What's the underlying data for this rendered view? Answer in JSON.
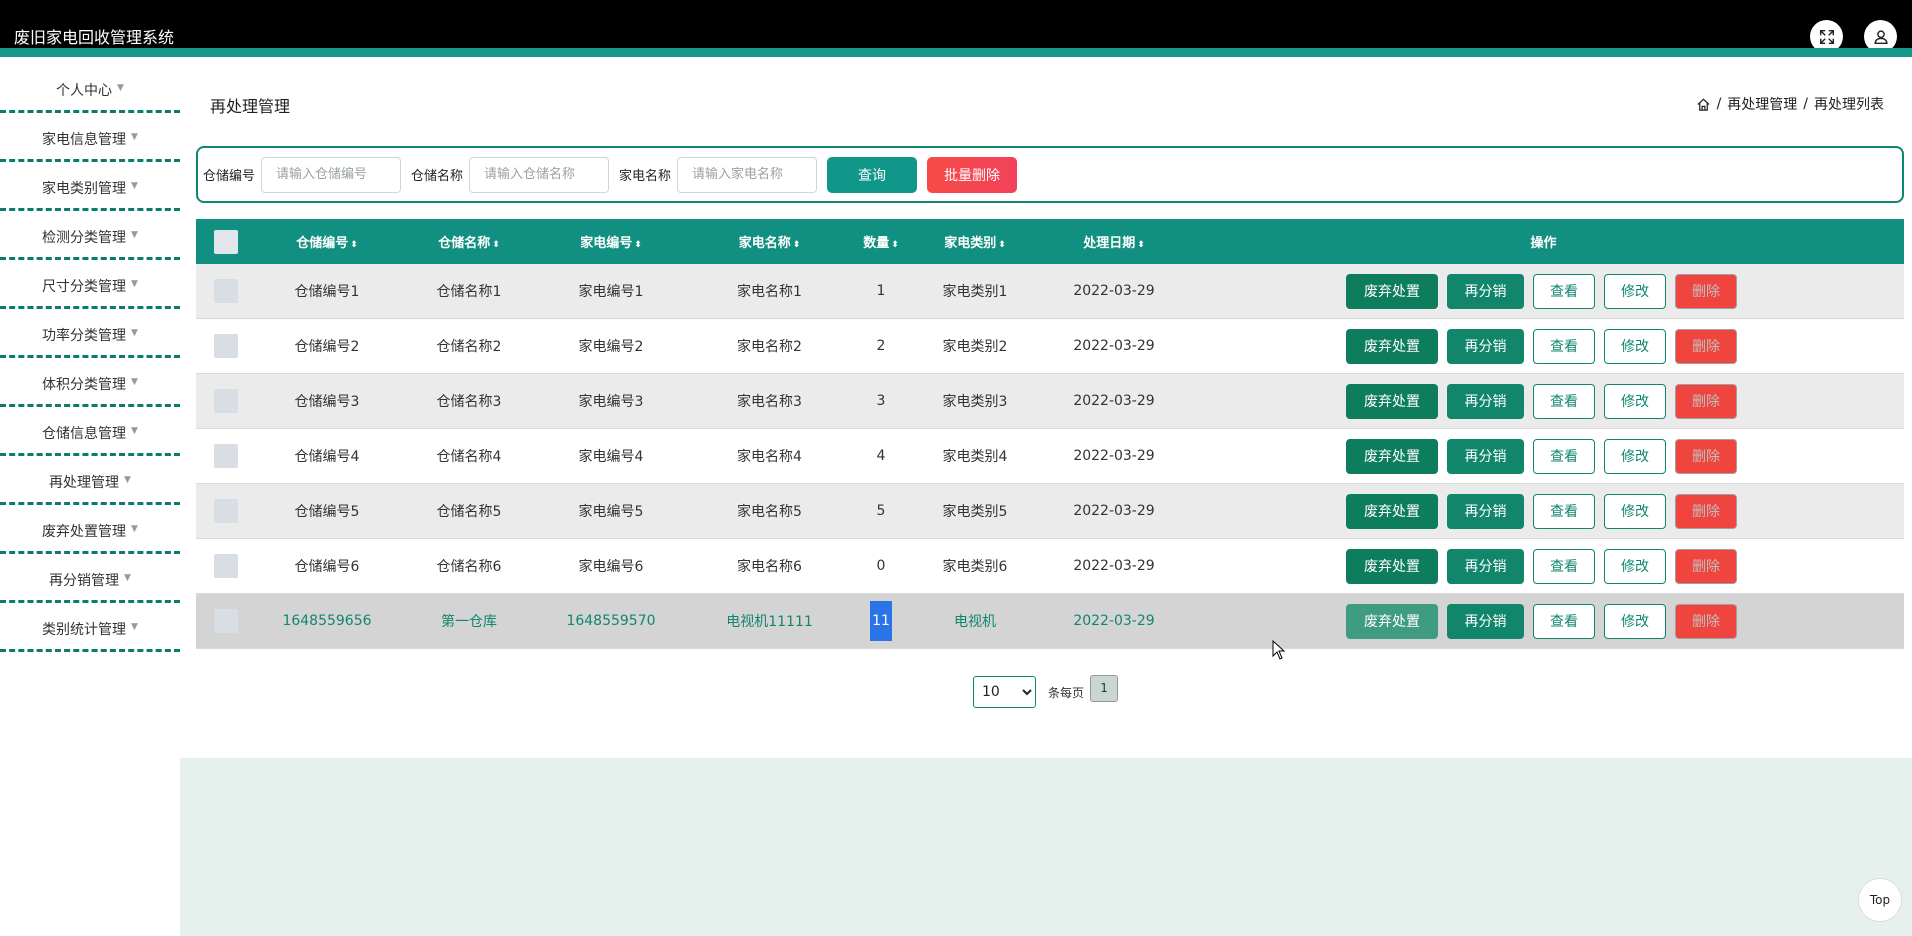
{
  "app": {
    "title": "废旧家电回收管理系统"
  },
  "header": {
    "fullscreen_icon": "fullscreen-icon",
    "user_icon": "user-icon"
  },
  "sidebar": {
    "items": [
      {
        "label": "个人中心"
      },
      {
        "label": "家电信息管理"
      },
      {
        "label": "家电类别管理"
      },
      {
        "label": "检测分类管理"
      },
      {
        "label": "尺寸分类管理"
      },
      {
        "label": "功率分类管理"
      },
      {
        "label": "体积分类管理"
      },
      {
        "label": "仓储信息管理"
      },
      {
        "label": "再处理管理"
      },
      {
        "label": "废弃处置管理"
      },
      {
        "label": "再分销管理"
      },
      {
        "label": "类别统计管理"
      }
    ],
    "caret": "▼"
  },
  "page": {
    "title": "再处理管理",
    "breadcrumb": {
      "home_icon": "home-icon",
      "sep": "/",
      "level1": "再处理管理",
      "level2": "再处理列表"
    }
  },
  "search": {
    "warehouse_no_label": "仓储编号",
    "warehouse_no_placeholder": "请输入仓储编号",
    "warehouse_name_label": "仓储名称",
    "warehouse_name_placeholder": "请输入仓储名称",
    "appliance_name_label": "家电名称",
    "appliance_name_placeholder": "请输入家电名称",
    "query_button": "查询",
    "bulk_delete_button": "批量删除"
  },
  "table": {
    "headers": {
      "warehouse_no": "仓储编号",
      "warehouse_name": "仓储名称",
      "appliance_no": "家电编号",
      "appliance_name": "家电名称",
      "quantity": "数量",
      "category": "家电类别",
      "date": "处理日期",
      "actions": "操作"
    },
    "sort_glyph": "⬍",
    "actions": {
      "discard": "废弃处置",
      "redistribute": "再分销",
      "view": "查看",
      "edit": "修改",
      "delete": "删除"
    },
    "rows": [
      {
        "warehouse_no": "仓储编号1",
        "warehouse_name": "仓储名称1",
        "appliance_no": "家电编号1",
        "appliance_name": "家电名称1",
        "quantity": "1",
        "category": "家电类别1",
        "date": "2022-03-29"
      },
      {
        "warehouse_no": "仓储编号2",
        "warehouse_name": "仓储名称2",
        "appliance_no": "家电编号2",
        "appliance_name": "家电名称2",
        "quantity": "2",
        "category": "家电类别2",
        "date": "2022-03-29"
      },
      {
        "warehouse_no": "仓储编号3",
        "warehouse_name": "仓储名称3",
        "appliance_no": "家电编号3",
        "appliance_name": "家电名称3",
        "quantity": "3",
        "category": "家电类别3",
        "date": "2022-03-29"
      },
      {
        "warehouse_no": "仓储编号4",
        "warehouse_name": "仓储名称4",
        "appliance_no": "家电编号4",
        "appliance_name": "家电名称4",
        "quantity": "4",
        "category": "家电类别4",
        "date": "2022-03-29"
      },
      {
        "warehouse_no": "仓储编号5",
        "warehouse_name": "仓储名称5",
        "appliance_no": "家电编号5",
        "appliance_name": "家电名称5",
        "quantity": "5",
        "category": "家电类别5",
        "date": "2022-03-29"
      },
      {
        "warehouse_no": "仓储编号6",
        "warehouse_name": "仓储名称6",
        "appliance_no": "家电编号6",
        "appliance_name": "家电名称6",
        "quantity": "0",
        "category": "家电类别6",
        "date": "2022-03-29"
      },
      {
        "warehouse_no": "1648559656",
        "warehouse_name": "第一仓库",
        "appliance_no": "1648559570",
        "appliance_name": "电视机11111",
        "quantity": "11",
        "category": "电视机",
        "date": "2022-03-29"
      }
    ]
  },
  "pagination": {
    "page_size": "10",
    "per_page_label": "条每页",
    "current_page": "1"
  },
  "top_button": "Top",
  "colors": {
    "header_bg": "#000000",
    "accent": "#14968a",
    "table_head": "#118f80",
    "delete": "#f0443f"
  }
}
